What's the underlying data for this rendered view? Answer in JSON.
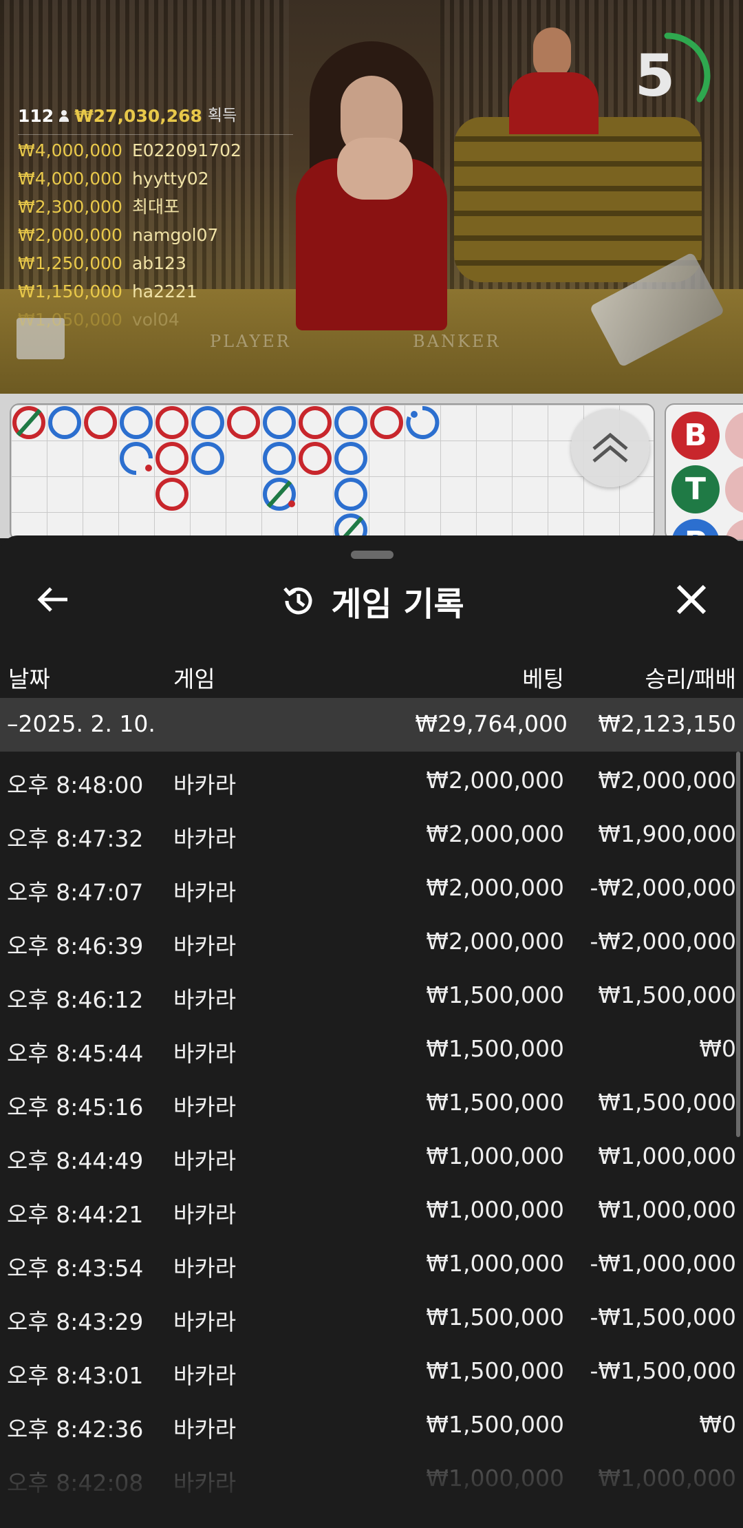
{
  "live_overlay": {
    "player_count": "112",
    "total_won": "₩27,030,268",
    "total_suffix": "획득",
    "winners": [
      {
        "amount": "₩4,000,000",
        "user": "E022091702"
      },
      {
        "amount": "₩4,000,000",
        "user": "hyytty02"
      },
      {
        "amount": "₩2,300,000",
        "user": "최대포"
      },
      {
        "amount": "₩2,000,000",
        "user": "namgol07"
      },
      {
        "amount": "₩1,250,000",
        "user": "ab123"
      },
      {
        "amount": "₩1,150,000",
        "user": "ha2221"
      },
      {
        "amount": "₩1,050,000",
        "user": "vol04"
      }
    ],
    "timer_seconds": "5",
    "timer_fraction_remaining": 0.35,
    "table_labels": {
      "player": "PLAYER",
      "banker": "BANKER"
    }
  },
  "roadmap": {
    "side_stats": [
      {
        "label": "B",
        "color": "#c8262c"
      },
      {
        "label": "T",
        "color": "#1f7a45"
      },
      {
        "label": "P",
        "color": "#2c6fcf"
      }
    ],
    "colors": {
      "banker": "#c8262c",
      "player": "#2c6fcf",
      "tie": "#1f7a45"
    }
  },
  "history_sheet": {
    "title": "게임 기록",
    "icons": {
      "back": "arrow-left-icon",
      "history": "history-icon",
      "close": "close-icon"
    },
    "columns": {
      "date": "날짜",
      "game": "게임",
      "bet": "베팅",
      "result": "승리/패배"
    },
    "day_summary": {
      "date": "–2025. 2. 10.",
      "bet": "₩29,764,000",
      "result": "₩2,123,150"
    },
    "rows": [
      {
        "time": "오후 8:48:00",
        "game": "바카라",
        "bet": "₩2,000,000",
        "result": "₩2,000,000"
      },
      {
        "time": "오후 8:47:32",
        "game": "바카라",
        "bet": "₩2,000,000",
        "result": "₩1,900,000"
      },
      {
        "time": "오후 8:47:07",
        "game": "바카라",
        "bet": "₩2,000,000",
        "result": "-₩2,000,000"
      },
      {
        "time": "오후 8:46:39",
        "game": "바카라",
        "bet": "₩2,000,000",
        "result": "-₩2,000,000"
      },
      {
        "time": "오후 8:46:12",
        "game": "바카라",
        "bet": "₩1,500,000",
        "result": "₩1,500,000"
      },
      {
        "time": "오후 8:45:44",
        "game": "바카라",
        "bet": "₩1,500,000",
        "result": "₩0"
      },
      {
        "time": "오후 8:45:16",
        "game": "바카라",
        "bet": "₩1,500,000",
        "result": "₩1,500,000"
      },
      {
        "time": "오후 8:44:49",
        "game": "바카라",
        "bet": "₩1,000,000",
        "result": "₩1,000,000"
      },
      {
        "time": "오후 8:44:21",
        "game": "바카라",
        "bet": "₩1,000,000",
        "result": "₩1,000,000"
      },
      {
        "time": "오후 8:43:54",
        "game": "바카라",
        "bet": "₩1,000,000",
        "result": "-₩1,000,000"
      },
      {
        "time": "오후 8:43:29",
        "game": "바카라",
        "bet": "₩1,500,000",
        "result": "-₩1,500,000"
      },
      {
        "time": "오후 8:43:01",
        "game": "바카라",
        "bet": "₩1,500,000",
        "result": "-₩1,500,000"
      },
      {
        "time": "오후 8:42:36",
        "game": "바카라",
        "bet": "₩1,500,000",
        "result": "₩0"
      },
      {
        "time": "오후 8:42:08",
        "game": "바카라",
        "bet": "₩1,000,000",
        "result": "₩1,000,000"
      }
    ]
  }
}
